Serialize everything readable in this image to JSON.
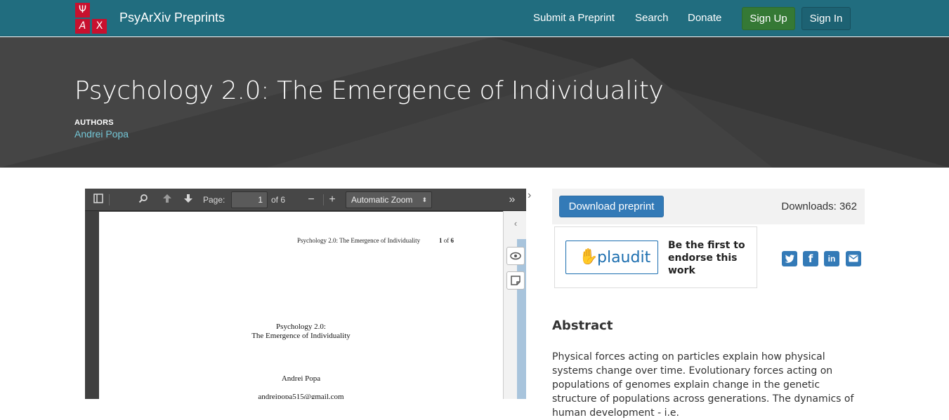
{
  "navbar": {
    "logo_glyphs": [
      "Ψ",
      "A",
      "X"
    ],
    "brand": "PsyArXiv Preprints",
    "links": [
      "Submit a Preprint",
      "Search",
      "Donate"
    ],
    "sign_up": "Sign Up",
    "sign_in": "Sign In",
    "colors": {
      "bar": "#216d7f",
      "sign_up": "#357935",
      "logo": "#c8102e"
    }
  },
  "header": {
    "title": "Psychology 2.0: The Emergence of Individuality",
    "authors_label": "AUTHORS",
    "author": "Andrei Popa"
  },
  "viewer": {
    "toolbar": {
      "sidebar_toggle_icon": "sidebar-icon",
      "search_icon": "search-icon",
      "prev_icon": "arrow-up-icon",
      "next_icon": "arrow-down-icon",
      "page_label": "Page:",
      "page_value": "1",
      "page_of": "of 6",
      "zoom_out": "−",
      "zoom_in": "+",
      "zoom_value": "Automatic Zoom",
      "tools_icon": "double-chevron-icon"
    },
    "page": {
      "running_header": "Psychology 2.0: The Emergence of Individuality",
      "page_num": "1",
      "page_of_word": "of",
      "page_total": "6",
      "title_line1": "Psychology 2.0:",
      "title_line2": "The Emergence of Individuality",
      "author": "Andrei Popa",
      "email": "andreipopa515@gmail.com"
    }
  },
  "sidebar": {
    "download_button": "Download preprint",
    "downloads": "Downloads: 362",
    "plaudit_word": "plaudit",
    "endorse_text": "Be the first to endorse this work",
    "share_icons": [
      "twitter-icon",
      "facebook-icon",
      "linkedin-icon",
      "email-icon"
    ],
    "abstract_heading": "Abstract",
    "abstract_text": "Physical forces acting on particles explain how physical systems change over time. Evolutionary forces acting on populations of genomes explain change in the genetic structure of populations across generations. The dynamics of human development - i.e."
  }
}
